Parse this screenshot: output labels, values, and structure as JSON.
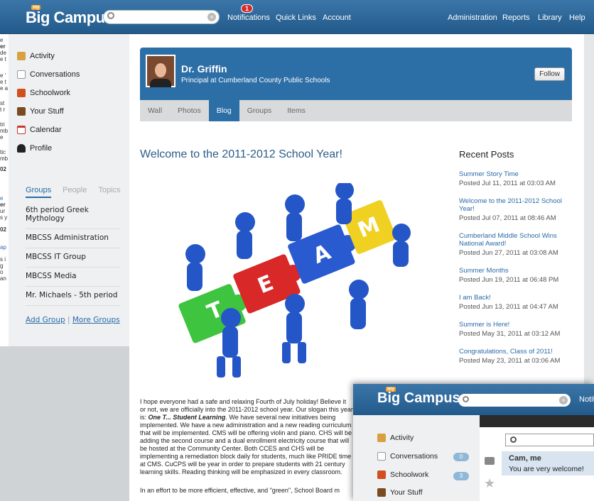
{
  "topbar": {
    "logo_my": "my",
    "logo": "Big Campus",
    "notifications_count": "1",
    "nav_left": [
      "Notifications",
      "Quick Links",
      "Account"
    ],
    "nav_right": [
      "Administration",
      "Reports",
      "Library",
      "Help"
    ]
  },
  "sidebar": {
    "menu": [
      "Activity",
      "Conversations",
      "Schoolwork",
      "Your Stuff",
      "Calendar",
      "Profile"
    ],
    "group_tabs": [
      "Groups",
      "People",
      "Topics"
    ],
    "groups": [
      "6th period Greek Mythology",
      "MBCSS Administration",
      "MBCSS IT Group",
      "MBCSS Media",
      "Mr. Michaels - 5th period"
    ],
    "add_group": "Add Group",
    "separator": "|",
    "more_groups": "More Groups"
  },
  "profile": {
    "name": "Dr. Griffin",
    "title": "Principal at Cumberland County Public Schools",
    "follow": "Follow",
    "tabs": [
      "Wall",
      "Photos",
      "Blog",
      "Groups",
      "Items"
    ]
  },
  "post": {
    "title": "Welcome to the 2011-2012 School Year!",
    "image_letters": [
      "T",
      "E",
      "A",
      "M"
    ],
    "para1_a": "I hope everyone had a safe and relaxing Fourth of July holiday! Believe it or not, we are officially into the 2011-2012 school year. Our slogan this year is: ",
    "para1_em": "One T... Student Learning",
    "para1_b": ". We have several new initiatives being implemented. We have a new administration and a new reading curriculum that will be implemented. CMS will be offering violin and piano. CHS will be adding the second course and a dual enrollment electricity course that will be hosted at the Community Center. Both CCES and CHS will be implementing a remediation block daily for students, much like PRIDE time at CMS. CuCPS will be year in order to prepare students with 21 century learning skills. Reading thinking will be emphasized in every classroom.",
    "para2": "In an effort to be more efficient, effective, and \"green\", School Board m"
  },
  "recent_posts": {
    "heading": "Recent Posts",
    "items": [
      {
        "title": "Summer Story Time",
        "date": "Posted Jul 11, 2011 at 03:03 AM"
      },
      {
        "title": "Welcome to the 2011-2012 School Year!",
        "date": "Posted Jul 07, 2011 at 08:46 AM"
      },
      {
        "title": "Cumberland Middle School Wins National Award!",
        "date": "Posted Jun 27, 2011 at 03:08 AM"
      },
      {
        "title": "Summer Months",
        "date": "Posted Jun 19, 2011 at 06:48 PM"
      },
      {
        "title": "I am Back!",
        "date": "Posted Jun 13, 2011 at 04:47 AM"
      },
      {
        "title": "Summer is Here!",
        "date": "Posted May 31, 2011 at 03:12 AM"
      },
      {
        "title": "Congratulations, Class of 2011!",
        "date": "Posted May 23, 2011 at 03:06 AM"
      }
    ]
  },
  "overlay": {
    "logo_my": "my",
    "logo": "Big Campus",
    "notif": "Notifi",
    "menu": [
      "Activity",
      "Conversations",
      "Schoolwork",
      "Your Stuff"
    ],
    "conversations_count": "0",
    "schoolwork_count": "3",
    "msg_name": "Cam, me",
    "msg_text": "You are very welcome!"
  },
  "left_strip": [
    "e",
    "er",
    "de",
    "e t",
    "e '",
    "e t",
    "e a",
    "st",
    "t r",
    "tri",
    "mb",
    "e",
    "tic",
    "mb",
    "02",
    "e",
    "er",
    "ur",
    "s y",
    "02",
    "ap",
    "s i",
    "g",
    "o",
    "an"
  ],
  "colors": {
    "brand_blue": "#2c6ea6",
    "link": "#2a6aa8",
    "alert_red": "#d42a2a"
  }
}
